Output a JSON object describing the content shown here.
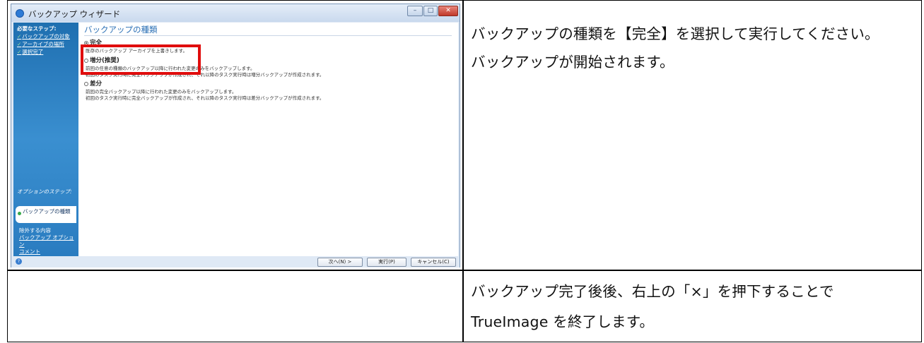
{
  "wizard": {
    "title": "バックアップ ウィザード",
    "window_buttons": {
      "minimize": "–",
      "maximize": "□",
      "close": "✕"
    },
    "sidebar": {
      "required_steps_heading": "必要なステップ:",
      "required_steps": [
        "バックアップの対象",
        "アーカイブの場所",
        "選択完了"
      ],
      "optional_steps_heading": "オプションのステップ:",
      "selected_step": "バックアップの種類",
      "optional_steps": [
        "除外する内容",
        "バックアップ オプション",
        "コメント"
      ]
    },
    "content": {
      "title": "バックアップの種類",
      "options": [
        {
          "label": "完全",
          "selected": true,
          "description": [
            "既存のバックアップ アーカイブを上書きします。"
          ]
        },
        {
          "label": "増分(推奨)",
          "selected": false,
          "description": [
            "前回の任意の種類のバックアップ以降に行われた変更のみをバックアップします。",
            "初回のタスク実行時に完全バックアップが作成され、それ以降のタスク実行時は増分バックアップが作成されます。"
          ]
        },
        {
          "label": "差分",
          "selected": false,
          "description": [
            "前回の完全バックアップ以降に行われた変更のみをバックアップします。",
            "初回のタスク実行時に完全バックアップが作成され、それ以降のタスク実行時は差分バックアップが作成されます。"
          ]
        }
      ]
    },
    "buttons": {
      "next": "次へ(N) >",
      "execute": "実行(P)",
      "cancel": "キャンセル(C)"
    },
    "highlight_color": "#e00d0d"
  },
  "instructions": {
    "step1_line1": "バックアップの種類を【完全】を選択して実行してください。",
    "step1_line2": "バックアップが開始されます。",
    "step2_line1": "バックアップ完了後後、右上の「×」を押下することで",
    "step2_line2": "TrueImage を終了します。"
  }
}
